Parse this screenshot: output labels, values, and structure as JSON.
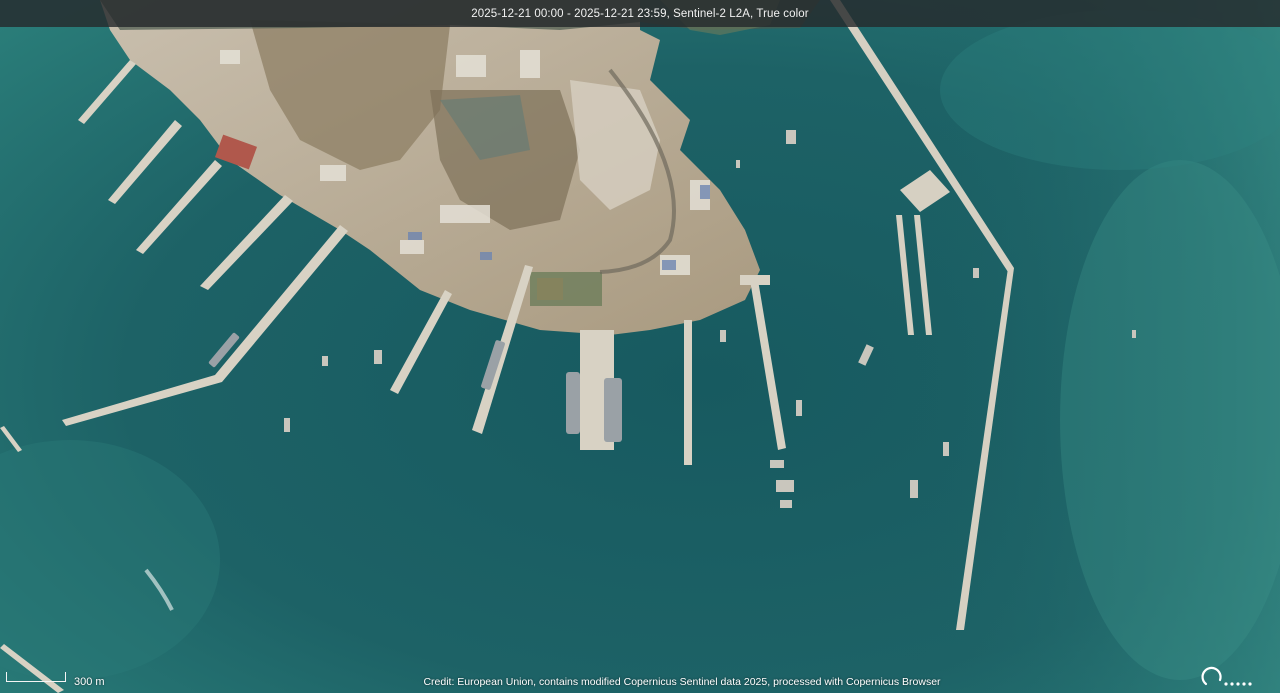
{
  "header": {
    "caption": "2025-12-21 00:00 - 2025-12-21 23:59, Sentinel-2 L2A, True color"
  },
  "scale": {
    "label": "300 m"
  },
  "footer": {
    "credit": "Credit: European Union, contains modified Copernicus Sentinel data 2025, processed with Copernicus Browser"
  },
  "icons": {
    "corner": "loading-indicator-icon"
  },
  "colors": {
    "sea": "#1c5f63",
    "shallow_sea": "#2a7a78",
    "land": "#b8aa90",
    "pier": "#d8d2c4"
  }
}
